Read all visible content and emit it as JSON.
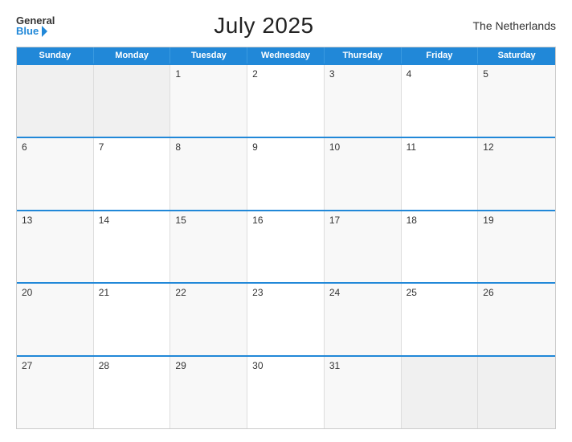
{
  "logo": {
    "general": "General",
    "blue": "Blue"
  },
  "title": "July 2025",
  "country": "The Netherlands",
  "days_of_week": [
    "Sunday",
    "Monday",
    "Tuesday",
    "Wednesday",
    "Thursday",
    "Friday",
    "Saturday"
  ],
  "weeks": [
    [
      {
        "day": "",
        "empty": true
      },
      {
        "day": "",
        "empty": true
      },
      {
        "day": "1",
        "empty": false
      },
      {
        "day": "2",
        "empty": false
      },
      {
        "day": "3",
        "empty": false
      },
      {
        "day": "4",
        "empty": false
      },
      {
        "day": "5",
        "empty": false
      }
    ],
    [
      {
        "day": "6",
        "empty": false
      },
      {
        "day": "7",
        "empty": false
      },
      {
        "day": "8",
        "empty": false
      },
      {
        "day": "9",
        "empty": false
      },
      {
        "day": "10",
        "empty": false
      },
      {
        "day": "11",
        "empty": false
      },
      {
        "day": "12",
        "empty": false
      }
    ],
    [
      {
        "day": "13",
        "empty": false
      },
      {
        "day": "14",
        "empty": false
      },
      {
        "day": "15",
        "empty": false
      },
      {
        "day": "16",
        "empty": false
      },
      {
        "day": "17",
        "empty": false
      },
      {
        "day": "18",
        "empty": false
      },
      {
        "day": "19",
        "empty": false
      }
    ],
    [
      {
        "day": "20",
        "empty": false
      },
      {
        "day": "21",
        "empty": false
      },
      {
        "day": "22",
        "empty": false
      },
      {
        "day": "23",
        "empty": false
      },
      {
        "day": "24",
        "empty": false
      },
      {
        "day": "25",
        "empty": false
      },
      {
        "day": "26",
        "empty": false
      }
    ],
    [
      {
        "day": "27",
        "empty": false
      },
      {
        "day": "28",
        "empty": false
      },
      {
        "day": "29",
        "empty": false
      },
      {
        "day": "30",
        "empty": false
      },
      {
        "day": "31",
        "empty": false
      },
      {
        "day": "",
        "empty": true
      },
      {
        "day": "",
        "empty": true
      }
    ]
  ]
}
